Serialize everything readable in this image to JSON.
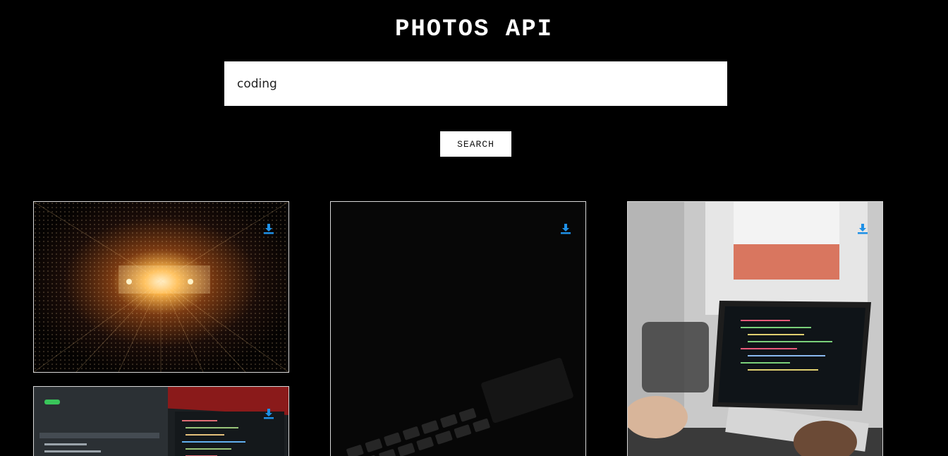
{
  "header": {
    "title": "PHOTOS API"
  },
  "search": {
    "value": "coding",
    "button_label": "SEARCH"
  },
  "gallery": {
    "photos": [
      {
        "subject": "light tunnel",
        "action_icon": "download-icon"
      },
      {
        "subject": "dark keyboard",
        "action_icon": "download-icon"
      },
      {
        "subject": "laptop code by window",
        "action_icon": "download-icon"
      },
      {
        "subject": "code editor monitors",
        "action_icon": "download-icon"
      }
    ]
  },
  "colors": {
    "background": "#000000",
    "accent": "#1e90e6",
    "card_border": "#d8d8d8"
  }
}
